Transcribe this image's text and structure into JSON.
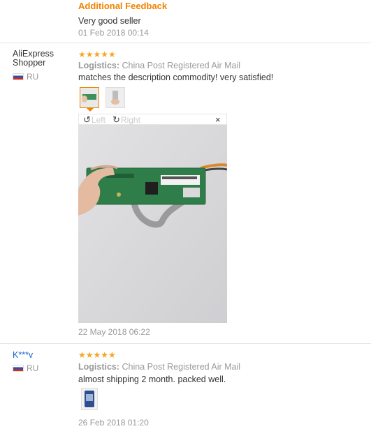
{
  "additional_feedback": {
    "title": "Additional Feedback",
    "text": "Very good seller",
    "date": "01 Feb 2018 00:14"
  },
  "reviews": [
    {
      "user_line1": "AliExpress",
      "user_line2": "Shopper",
      "country": "RU",
      "stars": "★★★★★",
      "logistics_label": "Logistics:",
      "logistics_value": "China Post Registered Air Mail",
      "comment": "matches the description commodity! very satisfied!",
      "viewer": {
        "rotate_left": "Left",
        "rotate_right": "Right",
        "close": "×"
      },
      "date": "22 May 2018 06:22"
    },
    {
      "user_line1": "K***v",
      "country": "RU",
      "stars": "★★★★★",
      "logistics_label": "Logistics:",
      "logistics_value": "China Post Registered Air Mail",
      "comment": "almost shipping 2 month. packed well.",
      "date": "26 Feb 2018 01:20"
    }
  ],
  "colors": {
    "accent": "#f08300",
    "star": "#f5a623",
    "link": "#1a66cc",
    "muted": "#999999"
  }
}
